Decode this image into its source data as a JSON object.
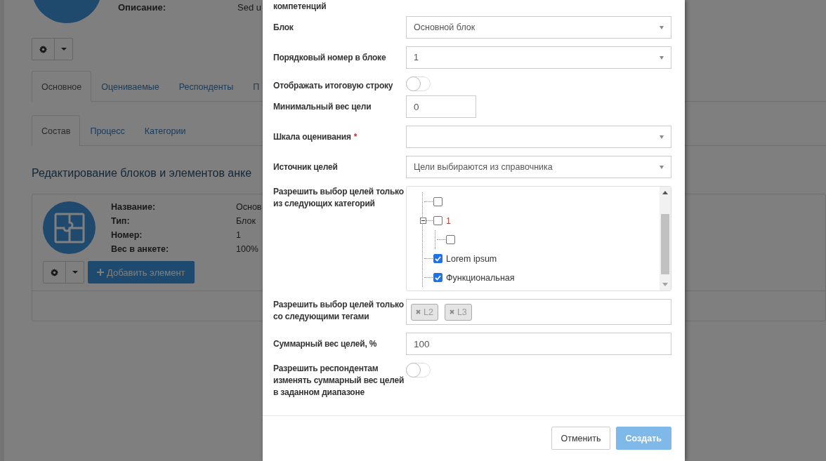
{
  "background": {
    "description_label": "Описание:",
    "description_value": "Sed u",
    "tabs": [
      {
        "label": "Основное",
        "selected": true
      },
      {
        "label": "Оцениваемые",
        "selected": false
      },
      {
        "label": "Респонденты",
        "selected": false
      },
      {
        "label": "П",
        "selected": false
      }
    ],
    "subtabs": [
      {
        "label": "Состав",
        "selected": true
      },
      {
        "label": "Процесс",
        "selected": false
      },
      {
        "label": "Категории",
        "selected": false
      }
    ],
    "heading": "Редактирование блоков и элементов анке",
    "block_card": {
      "fields": [
        {
          "label": "Название:",
          "value": "Основ"
        },
        {
          "label": "Тип:",
          "value": "Блок"
        },
        {
          "label": "Номер:",
          "value": "1"
        },
        {
          "label": "Вес в анкете:",
          "value": "100%"
        }
      ],
      "add_button": "Добавить элемент"
    }
  },
  "dialog": {
    "fields": [
      {
        "kind": "caption",
        "label": "компетенций"
      },
      {
        "kind": "select",
        "label": "Блок",
        "value": "Основной блок"
      },
      {
        "kind": "select",
        "label": "Порядковый номер в блоке",
        "value": "1"
      },
      {
        "kind": "toggle",
        "label": "Отображать итоговую строку",
        "on": false
      },
      {
        "kind": "input",
        "label": "Минимальный вес цели",
        "value": "0",
        "short": true
      },
      {
        "kind": "select",
        "label": "Шкала оценивания",
        "required_mark": "*"
      },
      {
        "kind": "select",
        "label": "Источник целей",
        "value": "Цели выбираются из справочника"
      },
      {
        "kind": "tree",
        "label": "Разрешить выбор целей только из следующих категорий",
        "nodes": [
          {
            "checked": false
          },
          {
            "label": "1",
            "checked": false,
            "expanded": true,
            "children": [
              {
                "checked": false
              }
            ]
          },
          {
            "label": "Lorem ipsum",
            "checked": true
          },
          {
            "label": "Функциональная",
            "checked": true
          }
        ]
      },
      {
        "kind": "tags",
        "label": "Разрешить выбор целей только со следующими тегами",
        "tags": [
          "L2",
          "L3"
        ]
      },
      {
        "kind": "input",
        "label": "Суммарный вес целей, %",
        "value": "100",
        "short": false
      },
      {
        "kind": "toggle",
        "label": "Разрешить респондентам изменять суммарный вес целей в заданном диапазоне",
        "on": false
      }
    ],
    "buttons": [
      {
        "label": "Отменить",
        "kind": "default",
        "disabled": false
      },
      {
        "label": "Создать",
        "kind": "primary",
        "disabled": true
      }
    ]
  }
}
